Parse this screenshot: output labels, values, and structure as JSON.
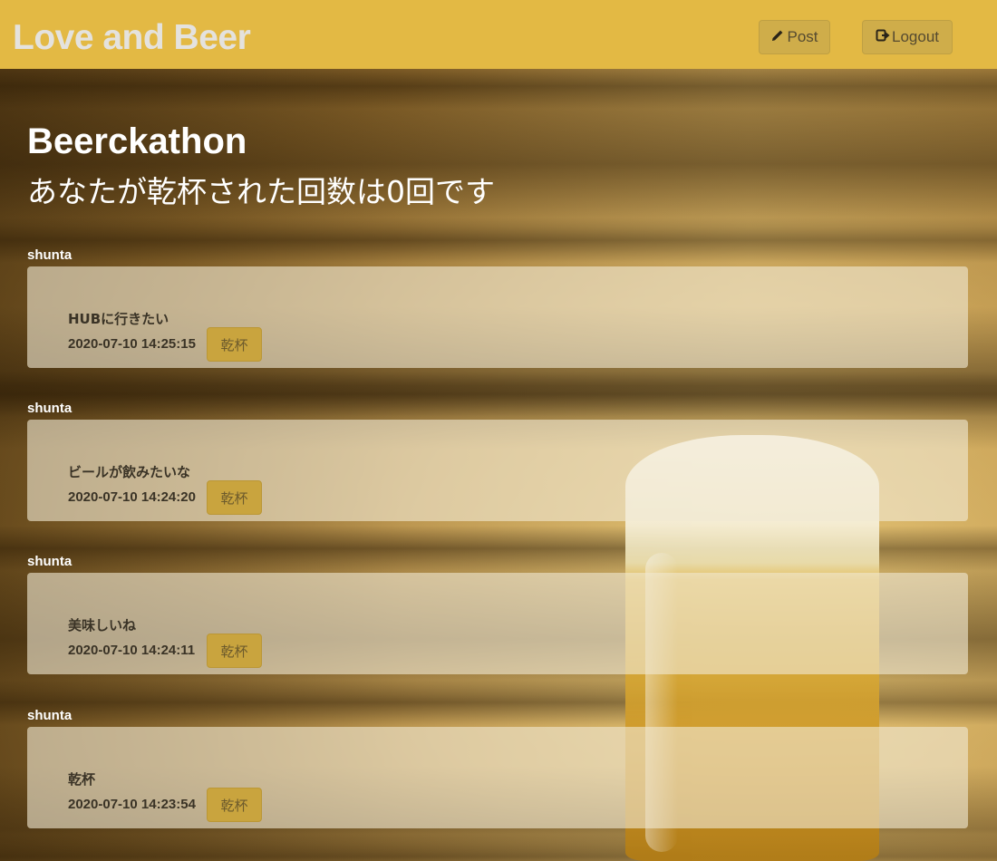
{
  "header": {
    "brand": "Love and Beer",
    "post_label": "Post",
    "logout_label": "Logout"
  },
  "main": {
    "title": "Beerckathon",
    "subtitle": "あなたが乾杯された回数は0回です"
  },
  "posts": [
    {
      "user": "shunta",
      "text": "HUBに行きたい",
      "time": "2020-07-10 14:25:15",
      "cheers_label": "乾杯"
    },
    {
      "user": "shunta",
      "text": "ビールが飲みたいな",
      "time": "2020-07-10 14:24:20",
      "cheers_label": "乾杯"
    },
    {
      "user": "shunta",
      "text": "美味しいね",
      "time": "2020-07-10 14:24:11",
      "cheers_label": "乾杯"
    },
    {
      "user": "shunta",
      "text": "乾杯",
      "time": "2020-07-10 14:23:54",
      "cheers_label": "乾杯"
    }
  ],
  "colors": {
    "header_bg": "#e3b944",
    "button_bg": "#c9a43e"
  },
  "icons": {
    "post": "pencil-icon",
    "logout": "sign-out-icon"
  }
}
